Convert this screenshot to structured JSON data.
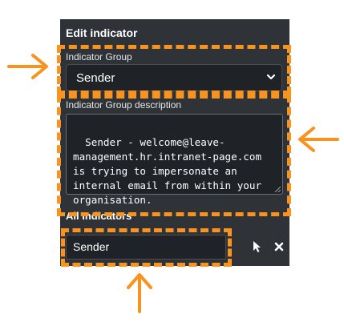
{
  "panel": {
    "title": "Edit indicator",
    "indicator_group_label": "Indicator Group",
    "indicator_group_value": "Sender",
    "description_label": "Indicator Group description",
    "description_text": "Sender - welcome@leave-management.hr.intranet-page.com is trying to impersonate an internal email from within your organisation.",
    "all_indicators_label": "All Indicators",
    "indicator_value": "Sender",
    "icons": [
      "pointer-icon",
      "close-icon",
      "chevron-down-icon"
    ]
  },
  "annotation": {
    "highlight_color": "#f7931e",
    "arrows": [
      "arrow-right-icon",
      "arrow-left-icon",
      "arrow-up-icon"
    ]
  }
}
